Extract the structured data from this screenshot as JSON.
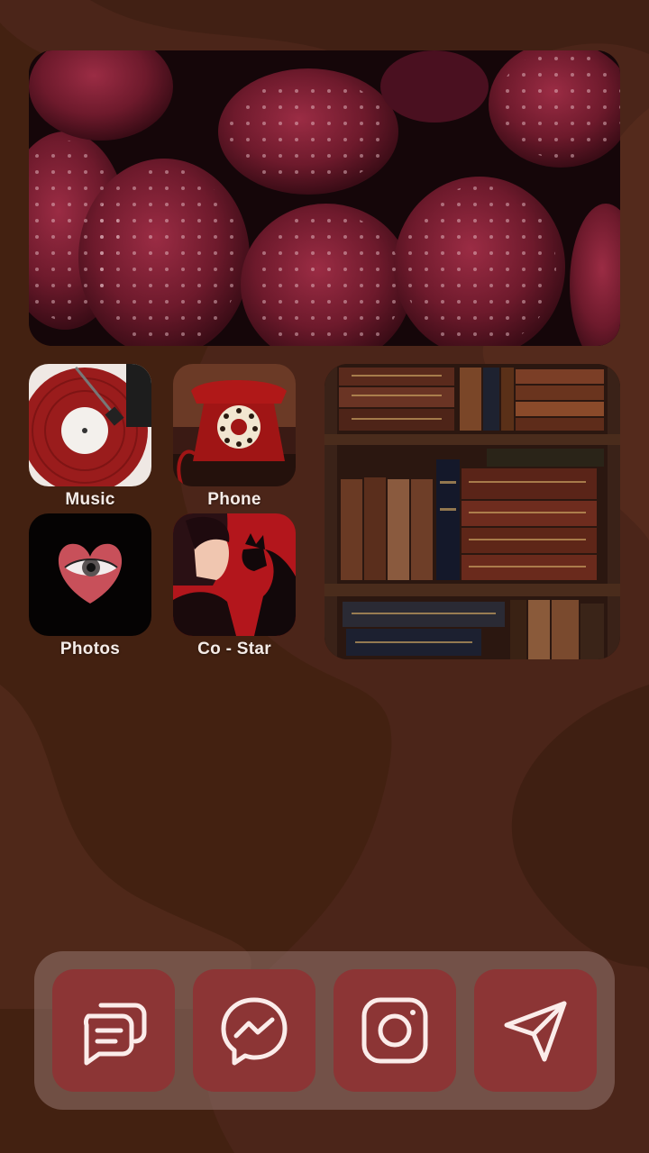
{
  "screen": {
    "background_color": "#4a2418",
    "accent_color": "#8c3535"
  },
  "widgets": {
    "top_photo": {
      "subject": "raspberries"
    },
    "side_photo": {
      "subject": "bookshelf"
    }
  },
  "apps": [
    {
      "label": "Music",
      "icon": "record-player-icon"
    },
    {
      "label": "Phone",
      "icon": "rotary-phone-icon"
    },
    {
      "label": "Photos",
      "icon": "heart-eye-icon"
    },
    {
      "label": "Co - Star",
      "icon": "woman-cat-icon"
    }
  ],
  "dock": [
    {
      "icon": "chat-bubbles-icon"
    },
    {
      "icon": "messenger-icon"
    },
    {
      "icon": "instagram-icon"
    },
    {
      "icon": "send-icon"
    }
  ]
}
